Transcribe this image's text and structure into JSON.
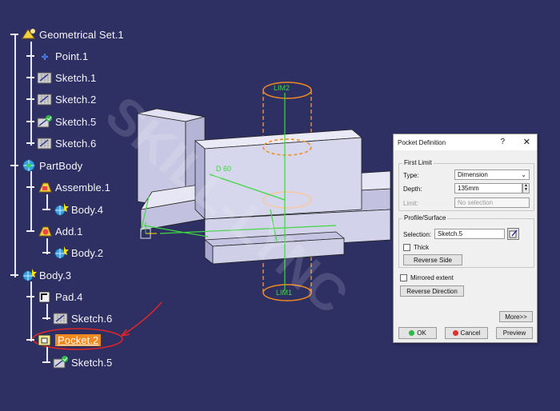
{
  "watermark": "SKILL-LYNC",
  "tree": [
    {
      "label": "Geometrical Set.1",
      "icon": "geometrical-set-icon"
    },
    {
      "label": "Point.1",
      "icon": "point-icon"
    },
    {
      "label": "Sketch.1",
      "icon": "sketch-icon"
    },
    {
      "label": "Sketch.2",
      "icon": "sketch-icon"
    },
    {
      "label": "Sketch.5",
      "icon": "sketch-icon"
    },
    {
      "label": "Sketch.6",
      "icon": "sketch-icon"
    },
    {
      "label": "PartBody",
      "icon": "part-body-icon"
    },
    {
      "label": "Assemble.1",
      "icon": "assemble-icon"
    },
    {
      "label": "Body.4",
      "icon": "body-icon"
    },
    {
      "label": "Add.1",
      "icon": "add-icon"
    },
    {
      "label": "Body.2",
      "icon": "body-icon"
    },
    {
      "label": "Body.3",
      "icon": "body-icon"
    },
    {
      "label": "Pad.4",
      "icon": "pad-icon"
    },
    {
      "label": "Sketch.6",
      "icon": "sketch-icon"
    },
    {
      "label": "Pocket.2",
      "icon": "pocket-icon"
    },
    {
      "label": "Sketch.5",
      "icon": "sketch-icon"
    }
  ],
  "viewport_labels": {
    "lim2": "LIM2",
    "lim1": "LIM1",
    "dim": "D 60"
  },
  "dialog": {
    "title": "Pocket Definition",
    "help": "?",
    "close": "✕",
    "first_limit": {
      "title": "First Limit",
      "type_label": "Type:",
      "type_value": "Dimension",
      "depth_label": "Depth:",
      "depth_value": "135mm",
      "limit_label": "Limit:",
      "limit_value": "No selection"
    },
    "profile": {
      "title": "Profile/Surface",
      "selection_label": "Selection:",
      "selection_value": "Sketch.5",
      "thick_label": "Thick",
      "reverse_side": "Reverse Side"
    },
    "mirrored_label": "Mirrored extent",
    "reverse_direction": "Reverse Direction",
    "more": "More>>",
    "ok": "OK",
    "cancel": "Cancel",
    "preview": "Preview"
  },
  "colors": {
    "background": "#2e2f63",
    "selection": "#f08a1e",
    "annotation": "#d8262a",
    "cylinder": "#f08a1e",
    "constraint": "#3fd83f"
  }
}
